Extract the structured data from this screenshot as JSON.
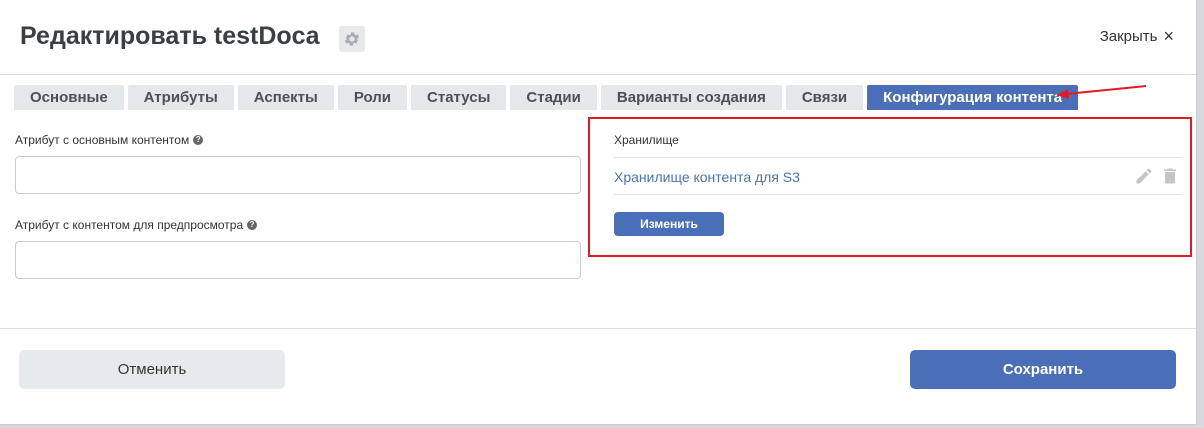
{
  "header": {
    "title": "Редактировать testDoca",
    "close_label": "Закрыть",
    "close_icon": "×"
  },
  "tabs": [
    {
      "label": "Основные",
      "active": false
    },
    {
      "label": "Атрибуты",
      "active": false
    },
    {
      "label": "Аспекты",
      "active": false
    },
    {
      "label": "Роли",
      "active": false
    },
    {
      "label": "Статусы",
      "active": false
    },
    {
      "label": "Стадии",
      "active": false
    },
    {
      "label": "Варианты создания",
      "active": false
    },
    {
      "label": "Связи",
      "active": false
    },
    {
      "label": "Конфигурация контента",
      "active": true
    }
  ],
  "form": {
    "main_content_label": "Атрибут с основным контентом",
    "main_content_value": "",
    "preview_content_label": "Атрибут с контентом для предпросмотра",
    "preview_content_value": "",
    "help_icon": "?"
  },
  "storage": {
    "label": "Хранилище",
    "item": "Хранилище контента для S3",
    "change_label": "Изменить"
  },
  "footer": {
    "cancel_label": "Отменить",
    "save_label": "Сохранить"
  },
  "colors": {
    "accent": "#4a6fb8",
    "highlight": "#e01b24"
  }
}
